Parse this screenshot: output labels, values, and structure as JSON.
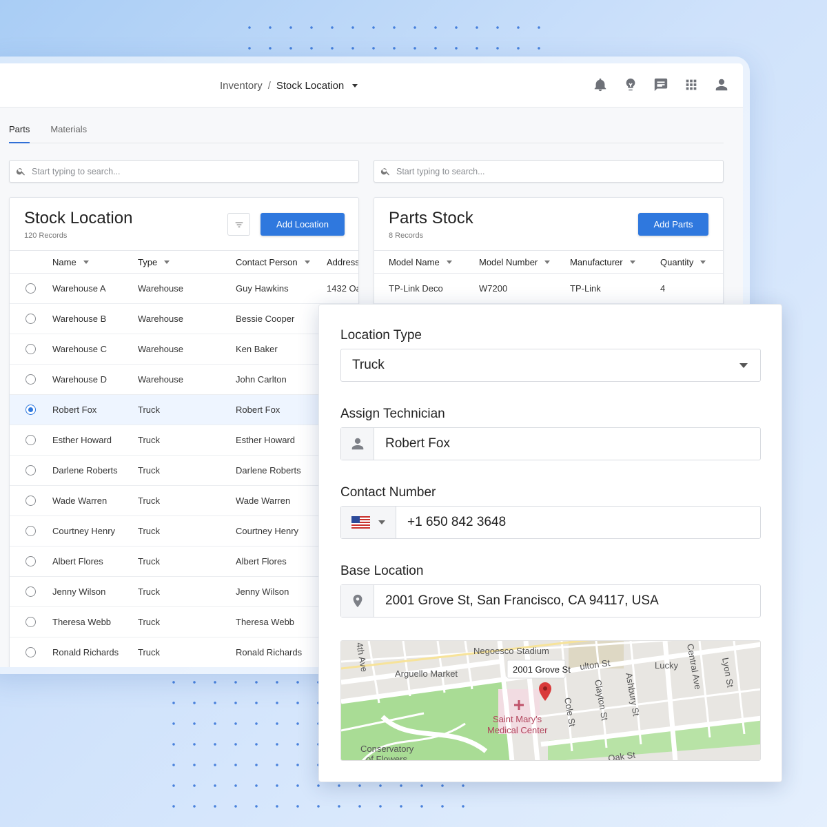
{
  "header": {
    "breadcrumb_root": "Inventory",
    "breadcrumb_sep": "/",
    "breadcrumb_current": "Stock Location",
    "icons": [
      "bell-icon",
      "lightbulb-icon",
      "chat-icon",
      "apps-grid-icon",
      "user-icon"
    ]
  },
  "tabs": [
    {
      "label": "Parts",
      "active": true
    },
    {
      "label": "Materials",
      "active": false
    }
  ],
  "search_left": {
    "placeholder": "Start typing to search..."
  },
  "search_right": {
    "placeholder": "Start typing to search..."
  },
  "stock_location": {
    "title": "Stock Location",
    "records": "120 Records",
    "add_label": "Add Location",
    "columns": [
      "Name",
      "Type",
      "Contact Person",
      "Address"
    ],
    "rows": [
      {
        "name": "Warehouse A",
        "type": "Warehouse",
        "contact": "Guy Hawkins",
        "address": "1432 Oa",
        "selected": false
      },
      {
        "name": "Warehouse B",
        "type": "Warehouse",
        "contact": "Bessie Cooper",
        "address": "",
        "selected": false
      },
      {
        "name": "Warehouse C",
        "type": "Warehouse",
        "contact": "Ken Baker",
        "address": "",
        "selected": false
      },
      {
        "name": "Warehouse D",
        "type": "Warehouse",
        "contact": "John Carlton",
        "address": "",
        "selected": false
      },
      {
        "name": "Robert Fox",
        "type": "Truck",
        "contact": "Robert Fox",
        "address": "",
        "selected": true
      },
      {
        "name": "Esther Howard",
        "type": "Truck",
        "contact": "Esther Howard",
        "address": "",
        "selected": false
      },
      {
        "name": "Darlene Roberts",
        "type": "Truck",
        "contact": "Darlene Roberts",
        "address": "",
        "selected": false
      },
      {
        "name": "Wade Warren",
        "type": "Truck",
        "contact": "Wade Warren",
        "address": "",
        "selected": false
      },
      {
        "name": "Courtney Henry",
        "type": "Truck",
        "contact": "Courtney Henry",
        "address": "",
        "selected": false
      },
      {
        "name": "Albert Flores",
        "type": "Truck",
        "contact": "Albert Flores",
        "address": "",
        "selected": false
      },
      {
        "name": "Jenny Wilson",
        "type": "Truck",
        "contact": "Jenny Wilson",
        "address": "",
        "selected": false
      },
      {
        "name": "Theresa Webb",
        "type": "Truck",
        "contact": "Theresa Webb",
        "address": "",
        "selected": false
      },
      {
        "name": "Ronald Richards",
        "type": "Truck",
        "contact": "Ronald Richards",
        "address": "",
        "selected": false
      }
    ]
  },
  "parts_stock": {
    "title": "Parts Stock",
    "records": "8 Records",
    "add_label": "Add Parts",
    "columns": [
      "Model Name",
      "Model Number",
      "Manufacturer",
      "Quantity"
    ],
    "rows": [
      {
        "model_name": "TP-Link Deco",
        "model_number": "W7200",
        "manufacturer": "TP-Link",
        "quantity": "4"
      }
    ]
  },
  "form": {
    "location_type_label": "Location Type",
    "location_type_value": "Truck",
    "technician_label": "Assign Technician",
    "technician_value": "Robert Fox",
    "contact_label": "Contact Number",
    "contact_value": "+1 650 842 3648",
    "base_label": "Base Location",
    "base_value": "2001 Grove St, San Francisco, CA 94117, USA"
  },
  "map": {
    "pin_label": "2001 Grove St",
    "labels": {
      "stadium": "Negoesco Stadium",
      "market": "Arguello Market",
      "fulton": "ulton St",
      "lucky": "Lucky",
      "central": "Central Ave",
      "lyon": "Lyon St",
      "clayton": "Clayton St",
      "ashbury": "Ashbury St",
      "cole": "Cole St",
      "hospital_1": "Saint Mary's",
      "hospital_2": "Medical Center",
      "conservatory_1": "Conservatory",
      "conservatory_2": "of Flowers",
      "fourth": "4th Ave",
      "oak": "Oak St"
    }
  },
  "colors": {
    "accent": "#2f78de",
    "pin": "#d93a3a",
    "park": "#a9dc95",
    "road": "#ffffff",
    "map_bg": "#e8e6e2"
  }
}
